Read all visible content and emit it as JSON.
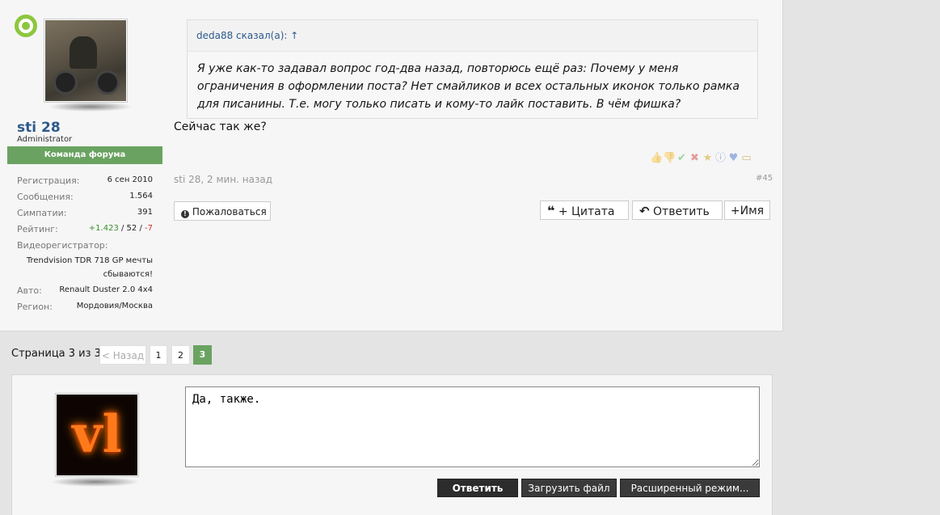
{
  "author": {
    "username": "sti 28",
    "title": "Administrator",
    "banner": "Команда форума",
    "info": [
      {
        "label": "Регистрация:",
        "value": "6 сен 2010"
      },
      {
        "label": "Сообщения:",
        "value": "1.564"
      },
      {
        "label": "Симпатии:",
        "value": "391"
      }
    ],
    "rating_label": "Рейтинг:",
    "rating_positive": "+1.423",
    "rating_sep1": " / ",
    "rating_neutral": "52",
    "rating_sep2": " / ",
    "rating_negative": "-7",
    "recorder_label": "Видеорегистратор:",
    "recorder_value": "Trendvision TDR 718 GP мечты сбываются!",
    "car_label": "Авто:",
    "car_value": "Renault Duster 2.0 4x4",
    "region_label": "Регион:",
    "region_value": "Мордовия/Москва"
  },
  "quote": {
    "header": "deda88 сказал(а): ↑",
    "text": "Я уже как-то задавал вопрос год-два назад, повторюсь ещё раз: Почему у меня ограничения в оформлении поста? Нет смайликов и всех остальных иконок только рамка для писанины. Т.е. могу только писать и кому-то лайк поставить. В чём фишка?"
  },
  "message": "Сейчас так же?",
  "reaction_icons": [
    "thumbs-up-icon",
    "thumbs-down-icon",
    "check-icon",
    "cross-icon",
    "star-icon",
    "info-icon",
    "heart-icon",
    "box-icon"
  ],
  "meta": {
    "author": "sti 28",
    "sep": ", ",
    "time": "2 мин. назад",
    "post_number": "#45"
  },
  "actions": {
    "report": "Пожаловаться",
    "quote": "+ Цитата",
    "reply": "Ответить",
    "name": "+Имя"
  },
  "pagination": {
    "label": "Страница 3 из 3",
    "prev": "< Назад",
    "pages": [
      "1",
      "2",
      "3"
    ],
    "current": "3"
  },
  "reply_box": {
    "text": "Да, также.",
    "submit": "Ответить",
    "upload": "Загрузить файл",
    "advanced": "Расширенный режим..."
  },
  "colors": {
    "accent_green": "#6aa361",
    "link_blue": "#2d5a8c",
    "online_green": "#8dc63f",
    "negative_red": "#cc3333"
  }
}
